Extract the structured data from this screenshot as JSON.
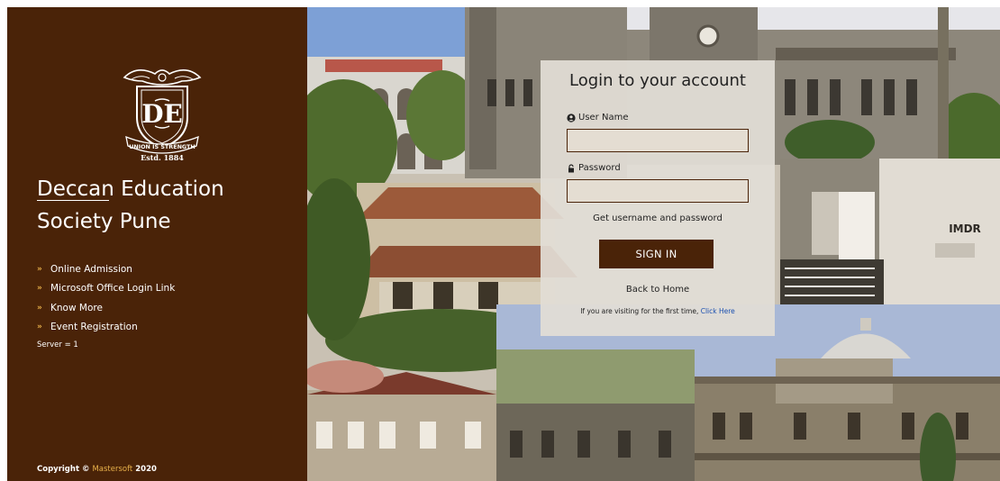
{
  "left_panel": {
    "emblem": {
      "motto": "UNION IS STRENGTH",
      "established": "Estd. 1884",
      "monogram": "DES"
    },
    "title_line1": "Deccan Education",
    "title_line2": "Society Pune",
    "links": [
      {
        "label": "Online Admission"
      },
      {
        "label": "Microsoft Office Login Link"
      },
      {
        "label": "Know More"
      },
      {
        "label": "Event Registration"
      }
    ],
    "bullet": "»",
    "server": "Server = 1",
    "copyright_prefix": "Copyright © ",
    "copyright_brand": "Mastersoft",
    "copyright_year": " 2020"
  },
  "collage": {
    "building_sign": "IMDR"
  },
  "login": {
    "title": "Login to your account",
    "username_label": "User Name",
    "username_value": "",
    "password_label": "Password",
    "password_value": "",
    "get_credentials": "Get username and password",
    "signin_label": "SIGN IN",
    "back_home": "Back to Home",
    "first_time_text": "If you are visiting for the first time, ",
    "first_time_link": "Click Here"
  },
  "colors": {
    "panel_brown": "#4a2308",
    "bullet_gold": "#e9b14a",
    "link_blue": "#1a4fb0"
  }
}
